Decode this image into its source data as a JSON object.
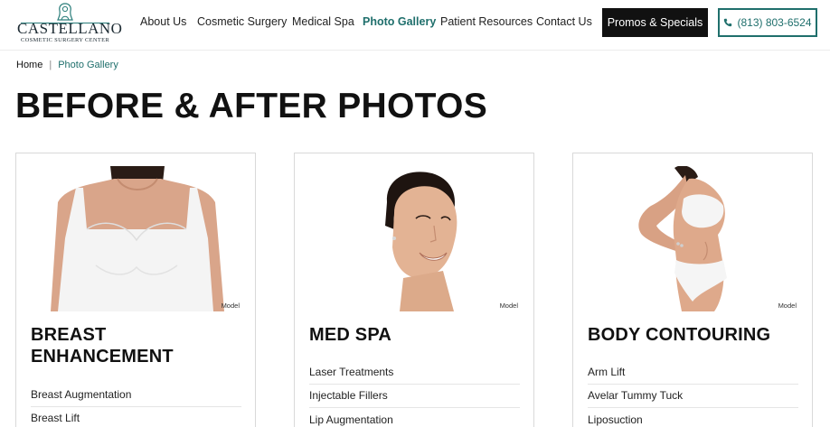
{
  "brand": {
    "name": "CASTELLANO",
    "tagline": "COSMETIC SURGERY CENTER"
  },
  "nav": {
    "items": [
      {
        "label": "About Us",
        "active": false
      },
      {
        "label": "Cosmetic Surgery",
        "active": false
      },
      {
        "label": "Medical Spa",
        "active": false
      },
      {
        "label": "Photo Gallery",
        "active": true
      },
      {
        "label": "Patient Resources",
        "active": false
      },
      {
        "label": "Contact Us",
        "active": false
      }
    ],
    "promo_label": "Promos & Specials",
    "phone_label": "(813) 803-6524",
    "phone_icon": "phone-icon"
  },
  "breadcrumb": {
    "home": "Home",
    "separator": "|",
    "current": "Photo Gallery"
  },
  "page": {
    "title": "BEFORE & AFTER PHOTOS"
  },
  "cards": [
    {
      "title": "BREAST ENHANCEMENT",
      "image_label": "Model",
      "links": [
        "Breast Augmentation",
        "Breast Lift"
      ]
    },
    {
      "title": "MED SPA",
      "image_label": "Model",
      "links": [
        "Laser Treatments",
        "Injectable Fillers",
        "Lip Augmentation"
      ]
    },
    {
      "title": "BODY CONTOURING",
      "image_label": "Model",
      "links": [
        "Arm Lift",
        "Avelar Tummy Tuck",
        "Liposuction"
      ]
    }
  ],
  "colors": {
    "accent": "#1f6f6c",
    "promo_bg": "#111111",
    "text": "#111111",
    "border": "#d9d9d9"
  }
}
